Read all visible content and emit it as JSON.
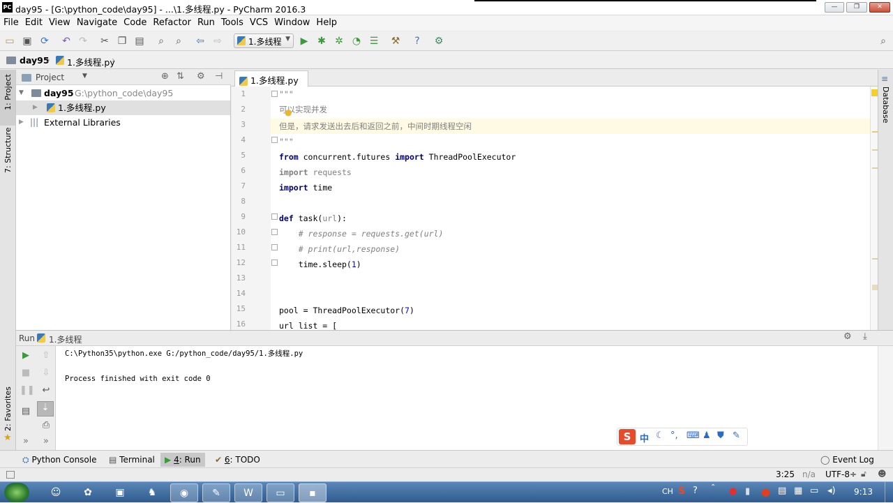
{
  "window": {
    "title": "day95 - [G:\\python_code\\day95] - ...\\1.多线程.py - PyCharm 2016.3",
    "logo_text": "PC",
    "controls": [
      "—",
      "❐",
      "✕"
    ]
  },
  "menu": [
    "File",
    "Edit",
    "View",
    "Navigate",
    "Code",
    "Refactor",
    "Run",
    "Tools",
    "VCS",
    "Window",
    "Help"
  ],
  "toolbar": {
    "run_config": "1.多线程"
  },
  "breadcrumb": {
    "project": "day95",
    "file": "1.多线程.py"
  },
  "left_strip": {
    "project_tab": "1: Project",
    "structure_tab": "7: Structure",
    "favorites_tab": "2: Favorites"
  },
  "project_panel": {
    "title": "Project",
    "root_name": "day95",
    "root_path": "G:\\python_code\\day95",
    "file": "1.多线程.py",
    "external": "External Libraries"
  },
  "editor": {
    "tab_label": "1.多线程.py",
    "line_numbers": [
      "1",
      "2",
      "3",
      "4",
      "5",
      "6",
      "7",
      "8",
      "9",
      "10",
      "11",
      "12",
      "13",
      "14",
      "15",
      "16"
    ],
    "lines": {
      "l1": "\"\"\"",
      "l2": "可以实现并发",
      "l3": "但是，请求发送出去后和返回之前，中间时期线程空闲",
      "l4": "\"\"\"",
      "l5_kw1": "from",
      "l5_mid": " concurrent.futures ",
      "l5_kw2": "import",
      "l5_end": " ThreadPoolExecutor",
      "l6_kw": "import",
      "l6_rest": " requests",
      "l7_kw": "import",
      "l7_rest": " time",
      "l9_kw": "def",
      "l9_name": " task(",
      "l9_param": "url",
      "l9_end": "):",
      "l10": "    # response = requests.get(url)",
      "l11": "    # print(url,response)",
      "l12_a": "    time.sleep(",
      "l12_n": "1",
      "l12_b": ")",
      "l15_a": "pool = ThreadPoolExecutor(",
      "l15_n": "7",
      "l15_b": ")",
      "l16": "url_list = ["
    }
  },
  "right_strip": {
    "database_tab": "Database"
  },
  "run_panel": {
    "label": "Run",
    "config": "1.多线程",
    "output_line1": "C:\\Python35\\python.exe G:/python_code/day95/1.多线程.py",
    "output_line2": "Process finished with exit code 0"
  },
  "ime": {
    "logo": "S",
    "mode": "中"
  },
  "bottom_tabs": {
    "python_console": "Python Console",
    "terminal": "Terminal",
    "run_num": "4",
    "run": ": Run",
    "todo_num": "6",
    "todo": ": TODO",
    "event_log": "Event Log"
  },
  "status": {
    "position": "3:25",
    "na": "n/a",
    "encoding": "UTF-8÷"
  },
  "taskbar": {
    "lang": "CH",
    "time": "9:13"
  },
  "colors": {
    "keyword": "#000080",
    "comment": "#808080",
    "number": "#0000ff",
    "current_line": "#fffae3",
    "run_green": "#3c9a3c"
  }
}
